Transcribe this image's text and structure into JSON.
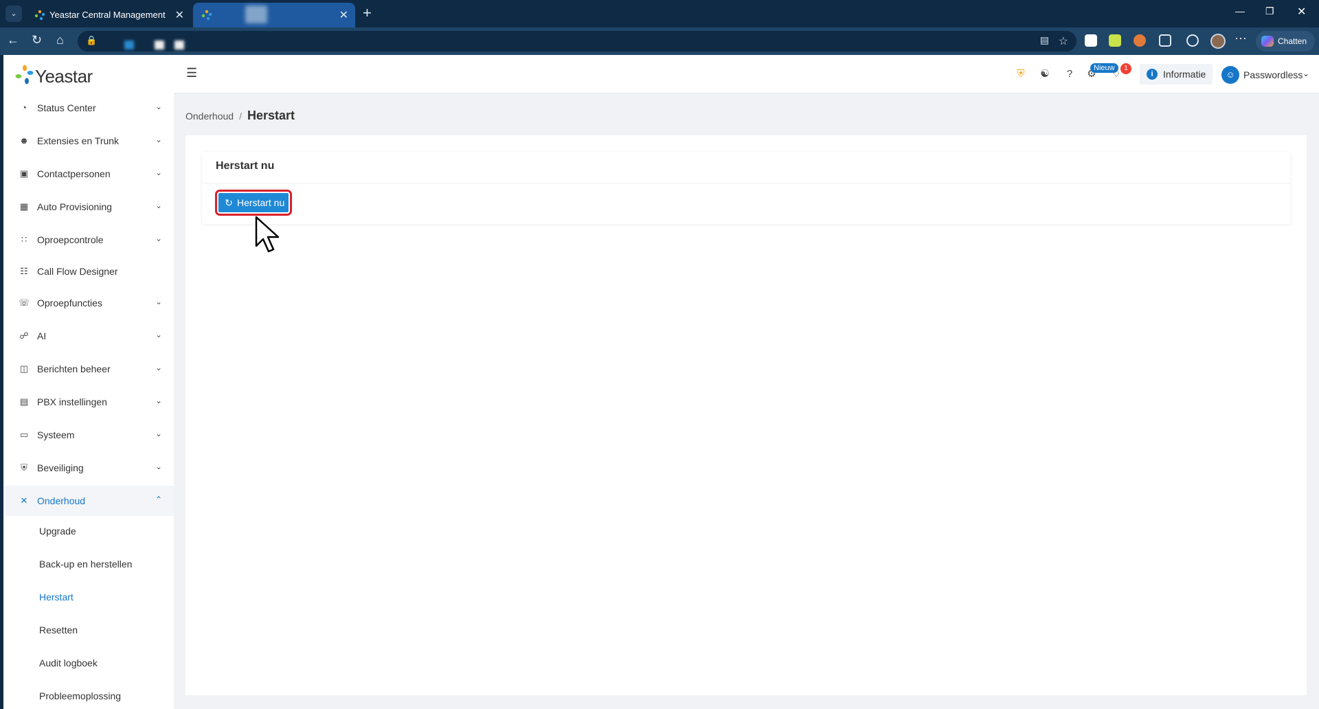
{
  "browser": {
    "tabs": [
      {
        "title": "Yeastar Central Management",
        "active": false
      },
      {
        "title": "",
        "active": true
      }
    ],
    "chat_label": "Chatten"
  },
  "sidebar": {
    "logo_text": "Yeastar",
    "items": [
      {
        "label": "Status Center",
        "icon": "gauge-icon",
        "expandable": true
      },
      {
        "label": "Extensies en Trunk",
        "icon": "users-icon",
        "expandable": true
      },
      {
        "label": "Contactpersonen",
        "icon": "contacts-icon",
        "expandable": true
      },
      {
        "label": "Auto Provisioning",
        "icon": "provisioning-icon",
        "expandable": true
      },
      {
        "label": "Oproepcontrole",
        "icon": "sliders-icon",
        "expandable": true
      },
      {
        "label": "Call Flow Designer",
        "icon": "flow-icon",
        "expandable": false
      },
      {
        "label": "Oproepfuncties",
        "icon": "phone-icon",
        "expandable": true
      },
      {
        "label": "AI",
        "icon": "headset-icon",
        "expandable": true
      },
      {
        "label": "Berichten beheer",
        "icon": "message-icon",
        "expandable": true
      },
      {
        "label": "PBX instellingen",
        "icon": "list-icon",
        "expandable": true
      },
      {
        "label": "Systeem",
        "icon": "monitor-icon",
        "expandable": true
      },
      {
        "label": "Beveiliging",
        "icon": "shield-icon",
        "expandable": true
      },
      {
        "label": "Onderhoud",
        "icon": "tools-icon",
        "expandable": true,
        "open": true
      }
    ],
    "sub_items": [
      {
        "label": "Upgrade"
      },
      {
        "label": "Back-up en herstellen"
      },
      {
        "label": "Herstart",
        "active": true
      },
      {
        "label": "Resetten"
      },
      {
        "label": "Audit logboek"
      },
      {
        "label": "Probleemoplossing"
      }
    ]
  },
  "header": {
    "new_badge": "Nieuw",
    "notification_count": "1",
    "info_label": "Informatie",
    "user_name": "Passwordless"
  },
  "breadcrumb": {
    "parent": "Onderhoud",
    "separator": "/",
    "current": "Herstart"
  },
  "card": {
    "title": "Herstart nu",
    "button_label": "Herstart nu"
  },
  "colors": {
    "accent": "#1677c8",
    "button": "#1f89d6",
    "highlight": "#d9202a",
    "browser_bg": "#0f2a45"
  }
}
